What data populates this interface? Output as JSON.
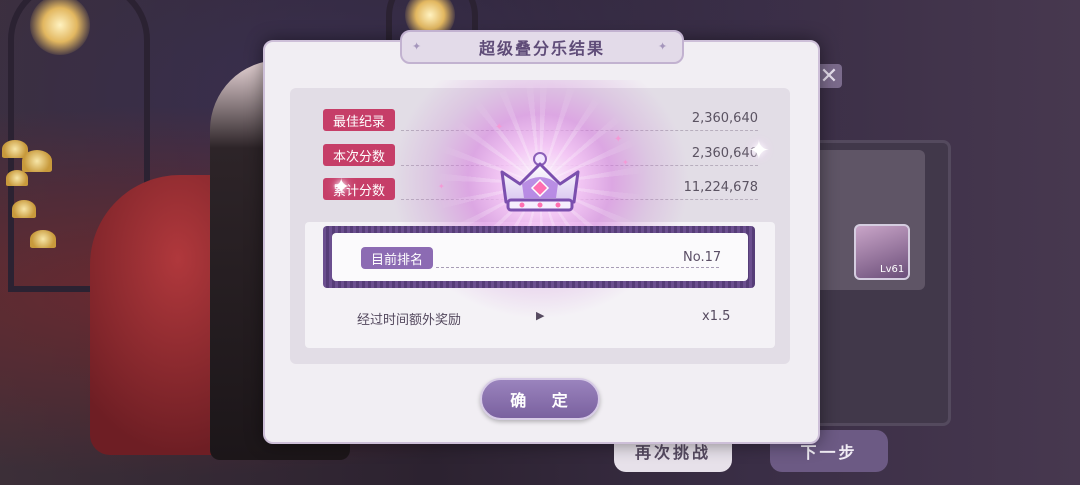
{
  "dialog": {
    "title": "超级叠分乐结果",
    "stats": [
      {
        "label": "最佳纪录",
        "value": "2,360,640"
      },
      {
        "label": "本次分数",
        "value": "2,360,640"
      },
      {
        "label": "累计分数",
        "value": "11,224,678"
      }
    ],
    "rank": {
      "label": "目前排名",
      "value": "No.17"
    },
    "bonus": {
      "label": "经过时间额外奖励",
      "value": "x1.5"
    },
    "confirm_label": "确 定"
  },
  "background": {
    "retry_label": "再次挑战",
    "next_label": "下一步",
    "avatar_level": "Lv61"
  },
  "icons": {
    "crown": "crown-icon",
    "arrow": "play-arrow-icon",
    "close": "close-icon",
    "sparkle": "sparkle-icon"
  },
  "colors": {
    "stat_label_bg": "#c63e68",
    "rank_label_bg": "#8c6bb3",
    "confirm_bg": "#8a72ae",
    "dialog_bg": "#f1eef3"
  }
}
